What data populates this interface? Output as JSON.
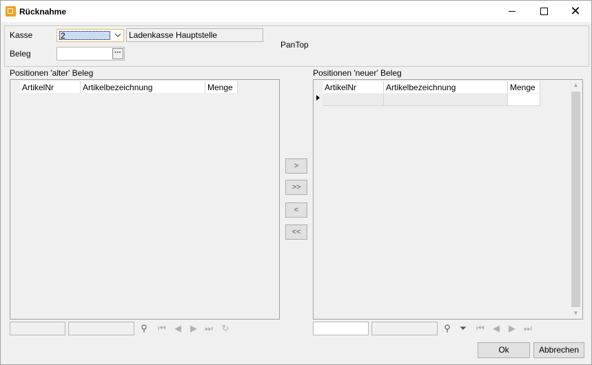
{
  "window": {
    "title": "Rücknahme",
    "controls": {
      "minimize": "—",
      "maximize": "□",
      "close": "✕"
    }
  },
  "header": {
    "kasse_label": "Kasse",
    "kasse_value": "2",
    "kasse_name": "Ladenkasse Hauptstelle",
    "beleg_label": "Beleg",
    "beleg_value": "",
    "beleg_button": "···",
    "system_name": "PanTop"
  },
  "old_receipt": {
    "title": "Positionen 'alter' Beleg",
    "columns": [
      "ArtikelNr",
      "Artikelbezeichnung",
      "Menge"
    ],
    "rows": []
  },
  "new_receipt": {
    "title": "Positionen 'neuer' Beleg",
    "columns": [
      "ArtikelNr",
      "Artikelbezeichnung",
      "Menge"
    ],
    "rows": [
      [
        "",
        "",
        ""
      ]
    ]
  },
  "transfer_buttons": {
    "move_one_right": ">",
    "move_all_right": ">>",
    "move_one_left": "<",
    "move_all_left": "<<"
  },
  "navigator_icons": {
    "search": "⚲",
    "filter": "⏷",
    "first": "⏮",
    "prev": "◀",
    "next": "▶",
    "last": "⏭",
    "refresh": "↻"
  },
  "footer": {
    "ok_label": "Ok",
    "cancel_label": "Abbrechen"
  }
}
